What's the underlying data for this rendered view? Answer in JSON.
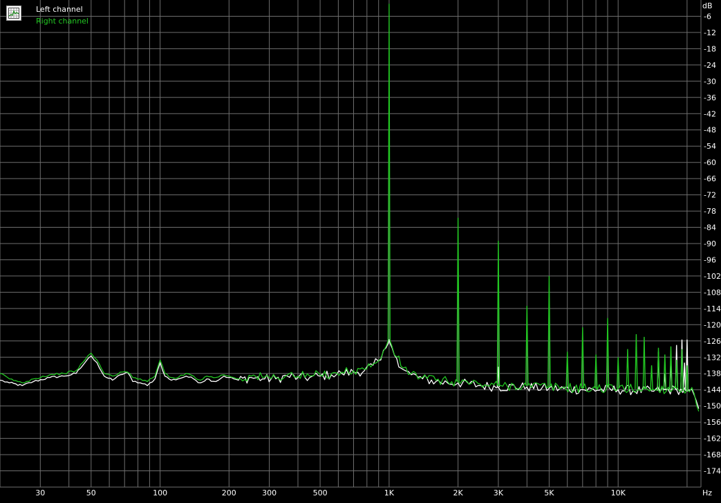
{
  "chart_data": {
    "type": "line",
    "title": "",
    "xlabel": "Hz",
    "ylabel": "dB",
    "xscale": "log",
    "xlim": [
      20,
      23000
    ],
    "ylim": [
      -180,
      0
    ],
    "grid": true,
    "legend_position": "top-left",
    "background_color": "#000000",
    "grid_color": "#6e6e6e",
    "x_ticks": [
      {
        "value": 30,
        "label": "30"
      },
      {
        "value": 50,
        "label": "50"
      },
      {
        "value": 100,
        "label": "100"
      },
      {
        "value": 200,
        "label": "200"
      },
      {
        "value": 300,
        "label": "300"
      },
      {
        "value": 500,
        "label": "500"
      },
      {
        "value": 1000,
        "label": "1K"
      },
      {
        "value": 2000,
        "label": "2K"
      },
      {
        "value": 3000,
        "label": "3K"
      },
      {
        "value": 5000,
        "label": "5K"
      },
      {
        "value": 10000,
        "label": "10K"
      }
    ],
    "y_ticks": [
      -6,
      -12,
      -18,
      -24,
      -30,
      -36,
      -42,
      -48,
      -54,
      -60,
      -66,
      -72,
      -78,
      -84,
      -90,
      -96,
      -102,
      -108,
      -114,
      -120,
      -126,
      -132,
      -138,
      -144,
      -150,
      -156,
      -162,
      -168,
      -174
    ],
    "series": [
      {
        "name": "Left channel",
        "color": "#ffffff",
        "points": [
          [
            20,
            -140.5
          ],
          [
            22,
            -141.5
          ],
          [
            25,
            -142.5
          ],
          [
            28,
            -141
          ],
          [
            33,
            -139.5
          ],
          [
            38,
            -139
          ],
          [
            43,
            -138
          ],
          [
            47,
            -134
          ],
          [
            50,
            -131.5
          ],
          [
            53,
            -134
          ],
          [
            57,
            -139
          ],
          [
            62,
            -140.5
          ],
          [
            67,
            -138.5
          ],
          [
            72,
            -137.5
          ],
          [
            76,
            -141
          ],
          [
            82,
            -141.5
          ],
          [
            88,
            -142.5
          ],
          [
            95,
            -140
          ],
          [
            100,
            -134
          ],
          [
            105,
            -139
          ],
          [
            112,
            -140.5
          ],
          [
            120,
            -140
          ],
          [
            130,
            -139
          ],
          [
            140,
            -140
          ],
          [
            150,
            -141.5
          ],
          [
            160,
            -140
          ],
          [
            175,
            -141
          ],
          [
            190,
            -139
          ],
          [
            200,
            -139.5
          ],
          [
            220,
            -140.5
          ],
          [
            250,
            -139.5
          ],
          [
            280,
            -140
          ],
          [
            320,
            -140
          ],
          [
            360,
            -139
          ],
          [
            400,
            -139.5
          ],
          [
            450,
            -139.5
          ],
          [
            500,
            -139
          ],
          [
            560,
            -138.5
          ],
          [
            620,
            -138
          ],
          [
            700,
            -137.5
          ],
          [
            780,
            -137
          ],
          [
            850,
            -135
          ],
          [
            920,
            -133
          ],
          [
            970,
            -128.5
          ],
          [
            990,
            -127
          ],
          [
            1000,
            -125.5
          ],
          [
            1010,
            -127
          ],
          [
            1030,
            -128.5
          ],
          [
            1080,
            -132.5
          ],
          [
            1150,
            -136.5
          ],
          [
            1250,
            -138.5
          ],
          [
            1400,
            -140
          ],
          [
            1600,
            -141
          ],
          [
            1800,
            -141.5
          ],
          [
            2000,
            -141.5
          ],
          [
            2500,
            -142.5
          ],
          [
            3000,
            -143
          ],
          [
            4000,
            -143
          ],
          [
            5000,
            -143.5
          ],
          [
            7000,
            -144
          ],
          [
            10000,
            -144
          ],
          [
            14000,
            -144.5
          ],
          [
            18000,
            -144
          ],
          [
            20000,
            -144.5
          ],
          [
            21500,
            -146
          ],
          [
            22500,
            -151
          ]
        ],
        "harmonics": [
          [
            3000,
            -135.5
          ],
          [
            15000,
            -130
          ],
          [
            16000,
            -138
          ],
          [
            17000,
            -133
          ],
          [
            18000,
            -127.5
          ],
          [
            19000,
            -125.5
          ],
          [
            19500,
            -134
          ],
          [
            20000,
            -125.5
          ]
        ]
      },
      {
        "name": "Right channel",
        "color": "#22c622",
        "points": [
          [
            20,
            -138
          ],
          [
            22,
            -140
          ],
          [
            25,
            -141.5
          ],
          [
            28,
            -140
          ],
          [
            33,
            -138.5
          ],
          [
            38,
            -138
          ],
          [
            43,
            -137
          ],
          [
            47,
            -133
          ],
          [
            50,
            -130.5
          ],
          [
            53,
            -133
          ],
          [
            57,
            -138
          ],
          [
            62,
            -139
          ],
          [
            67,
            -137.5
          ],
          [
            72,
            -137.5
          ],
          [
            76,
            -139.5
          ],
          [
            82,
            -140
          ],
          [
            88,
            -141
          ],
          [
            95,
            -139
          ],
          [
            100,
            -133
          ],
          [
            105,
            -138
          ],
          [
            112,
            -139.5
          ],
          [
            120,
            -139.5
          ],
          [
            130,
            -138
          ],
          [
            140,
            -139
          ],
          [
            150,
            -140.5
          ],
          [
            160,
            -139
          ],
          [
            175,
            -139.5
          ],
          [
            190,
            -138.5
          ],
          [
            200,
            -139
          ],
          [
            220,
            -140
          ],
          [
            250,
            -139
          ],
          [
            280,
            -139.5
          ],
          [
            320,
            -139.5
          ],
          [
            360,
            -138.5
          ],
          [
            400,
            -139
          ],
          [
            450,
            -139
          ],
          [
            500,
            -138.5
          ],
          [
            560,
            -138
          ],
          [
            620,
            -137.5
          ],
          [
            700,
            -137
          ],
          [
            780,
            -136.5
          ],
          [
            850,
            -134.5
          ],
          [
            920,
            -132.5
          ],
          [
            970,
            -128
          ],
          [
            990,
            -126
          ],
          [
            1000,
            -1.5
          ],
          [
            1010,
            -126
          ],
          [
            1030,
            -128
          ],
          [
            1080,
            -132
          ],
          [
            1150,
            -136
          ],
          [
            1250,
            -138
          ],
          [
            1400,
            -139.5
          ],
          [
            1600,
            -140.5
          ],
          [
            1800,
            -141
          ],
          [
            2000,
            -141
          ],
          [
            2500,
            -142
          ],
          [
            3000,
            -142.5
          ],
          [
            4000,
            -142.5
          ],
          [
            5000,
            -143
          ],
          [
            7000,
            -143.5
          ],
          [
            10000,
            -143.5
          ],
          [
            14000,
            -144
          ],
          [
            18000,
            -143.5
          ],
          [
            20000,
            -144
          ],
          [
            21500,
            -145.5
          ],
          [
            22500,
            -152
          ]
        ],
        "harmonics": [
          [
            2000,
            -80.5
          ],
          [
            3000,
            -89
          ],
          [
            4000,
            -113
          ],
          [
            5000,
            -102
          ],
          [
            6000,
            -130
          ],
          [
            7000,
            -121
          ],
          [
            8000,
            -131
          ],
          [
            9000,
            -117.5
          ],
          [
            10000,
            -132
          ],
          [
            11000,
            -129
          ],
          [
            12000,
            -123.5
          ],
          [
            13000,
            -124.5
          ],
          [
            14000,
            -135
          ],
          [
            15000,
            -128.5
          ],
          [
            16000,
            -131
          ],
          [
            17000,
            -128
          ],
          [
            18000,
            -133
          ],
          [
            19000,
            -129
          ],
          [
            20000,
            -135
          ]
        ]
      }
    ]
  }
}
